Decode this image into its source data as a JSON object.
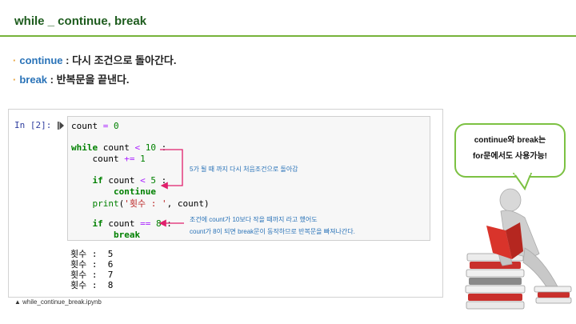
{
  "slide": {
    "title": "while _ continue, break",
    "bullets": [
      {
        "keyword": "continue",
        "text": " : 다시 조건으로 돌아간다."
      },
      {
        "keyword": "break",
        "text": " : 반복문을 끝낸다."
      }
    ]
  },
  "notebook": {
    "prompt": "In [2]:",
    "code_lines": [
      "count = 0",
      "while count < 10 :",
      "    count += 1",
      "    if count < 5 :",
      "        continue",
      "    print('횟수 : ', count)",
      "    if count == 8 :",
      "        break"
    ],
    "output": [
      "횟수 :  5",
      "횟수 :  6",
      "횟수 :  7",
      "횟수 :  8"
    ],
    "filename": "▲ while_continue_break.ipynb"
  },
  "annotations": {
    "continue_note": "5가 될 때 까지 다시 처음조건으로 돌아감",
    "break_note_line1": "조건에 count가 10보다 작을 때까지 라고 했어도",
    "break_note_line2": "count가 8이 되면 break문이 동작하므로 반복문을 빠져나간다."
  },
  "callout": {
    "line1": "continue와 break는",
    "line2": "for문에서도 사용가능!"
  },
  "colors": {
    "title": "#1e5c1e",
    "rule": "#76b33a",
    "keyword": "#2a73b8",
    "bullet_dot": "#e8a23a",
    "arrow": "#e0206c",
    "bubble_border": "#7cc142"
  }
}
